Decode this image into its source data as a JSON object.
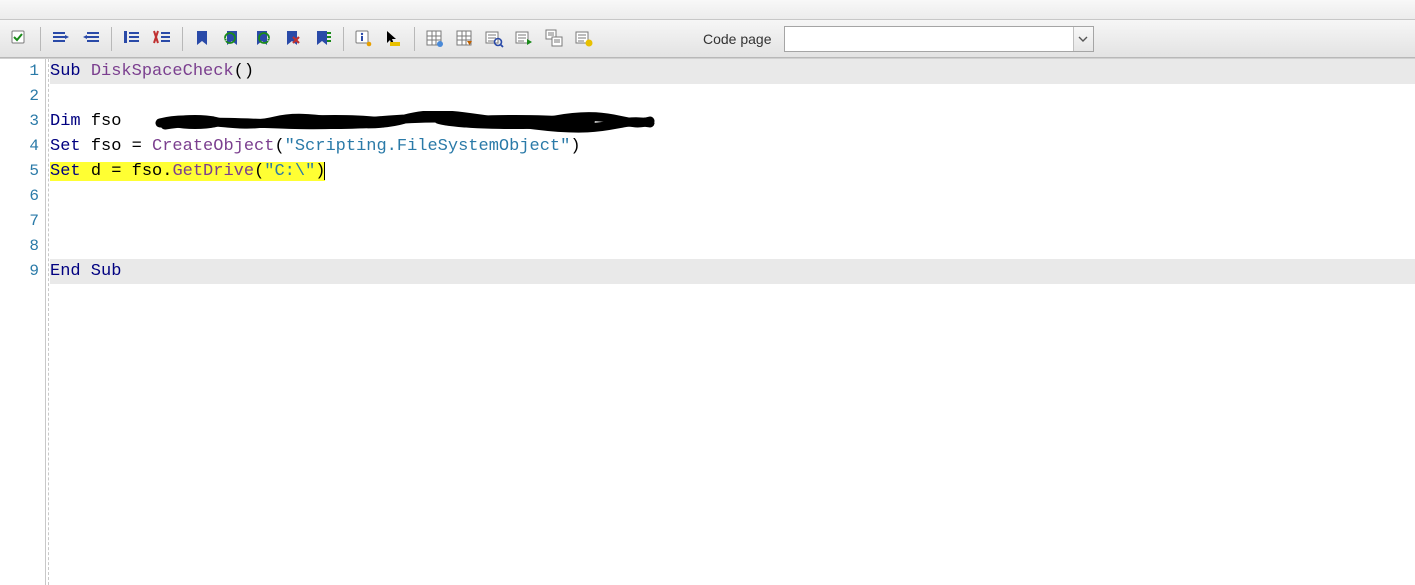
{
  "toolbar": {
    "code_page_label": "Code page",
    "code_page_value": "",
    "buttons": [
      {
        "name": "validate-icon"
      },
      {
        "sep": true
      },
      {
        "name": "indent-icon"
      },
      {
        "name": "outdent-icon"
      },
      {
        "sep": true
      },
      {
        "name": "comment-icon"
      },
      {
        "name": "uncomment-icon"
      },
      {
        "sep": true
      },
      {
        "name": "bookmark-icon"
      },
      {
        "name": "prev-bookmark-icon"
      },
      {
        "name": "next-bookmark-icon"
      },
      {
        "name": "clear-bookmarks-icon"
      },
      {
        "name": "goto-bookmark-icon"
      },
      {
        "sep": true
      },
      {
        "name": "info-icon"
      },
      {
        "name": "cursor-icon"
      },
      {
        "sep": true
      },
      {
        "name": "grid1-icon"
      },
      {
        "name": "grid2-icon"
      },
      {
        "name": "find-icon"
      },
      {
        "name": "findnext-icon"
      },
      {
        "name": "replace-icon"
      },
      {
        "name": "highlight-icon"
      }
    ]
  },
  "code": {
    "lines": [
      {
        "n": 1,
        "shade": true,
        "tokens": [
          {
            "cls": "kw",
            "t": "Sub "
          },
          {
            "cls": "ident",
            "t": "DiskSpaceCheck"
          },
          {
            "cls": "op",
            "t": "()"
          }
        ]
      },
      {
        "n": 2,
        "tokens": []
      },
      {
        "n": 3,
        "scribble": true,
        "tokens": [
          {
            "cls": "kw",
            "t": "Dim "
          },
          {
            "cls": "plain",
            "t": "fso"
          }
        ]
      },
      {
        "n": 4,
        "tokens": [
          {
            "cls": "kw",
            "t": "Set "
          },
          {
            "cls": "plain",
            "t": "fso "
          },
          {
            "cls": "op",
            "t": "= "
          },
          {
            "cls": "ident",
            "t": "CreateObject"
          },
          {
            "cls": "op",
            "t": "("
          },
          {
            "cls": "str",
            "t": "\"Scripting.FileSystemObject\""
          },
          {
            "cls": "op",
            "t": ")"
          }
        ]
      },
      {
        "n": 5,
        "highlight": true,
        "caret": true,
        "tokens": [
          {
            "cls": "kw",
            "t": "Set "
          },
          {
            "cls": "plain",
            "t": "d "
          },
          {
            "cls": "op",
            "t": "= "
          },
          {
            "cls": "plain",
            "t": "fso"
          },
          {
            "cls": "op",
            "t": "."
          },
          {
            "cls": "ident",
            "t": "GetDrive"
          },
          {
            "cls": "op",
            "t": "("
          },
          {
            "cls": "str",
            "t": "\"C:\\\""
          },
          {
            "cls": "op",
            "t": ")"
          }
        ]
      },
      {
        "n": 6,
        "tokens": []
      },
      {
        "n": 7,
        "tokens": []
      },
      {
        "n": 8,
        "tokens": []
      },
      {
        "n": 9,
        "shade": true,
        "tokens": [
          {
            "cls": "kw",
            "t": "End Sub"
          }
        ]
      }
    ]
  }
}
